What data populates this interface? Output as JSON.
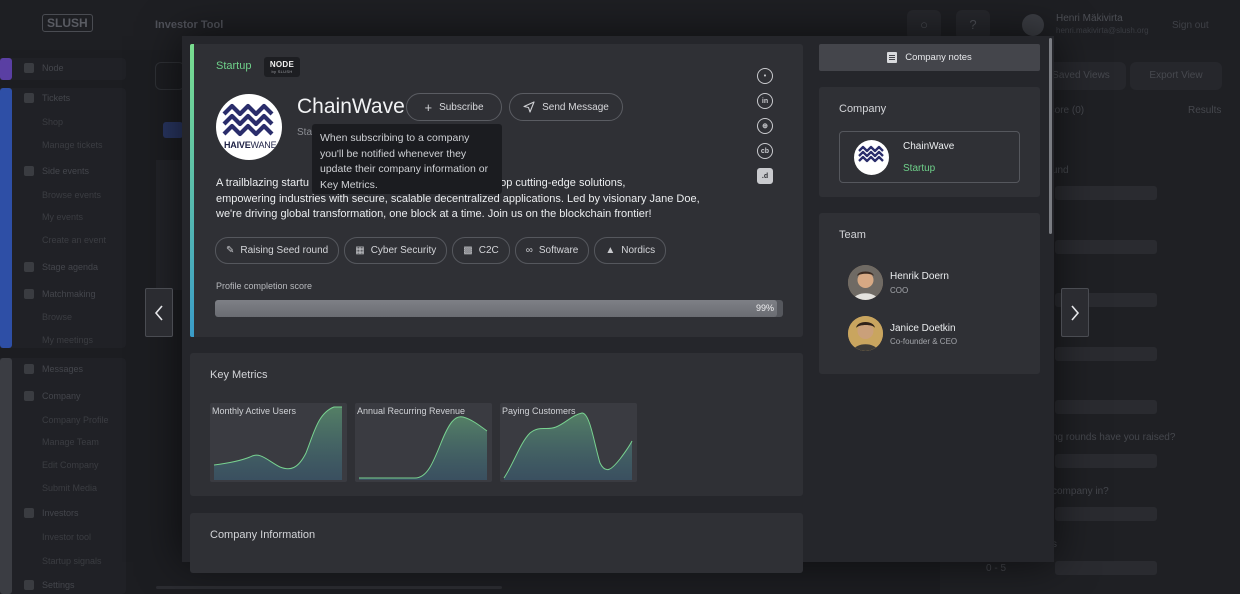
{
  "background": {
    "logo": "SLUSH",
    "page_title": "Investor Tool",
    "user_name": "Henri Mäkivirta",
    "user_email": "henri.makivirta@slush.org",
    "sign_out": "Sign out",
    "saved_views": "Saved Views",
    "export_view": "Export View",
    "score_col": "Score (0)",
    "results_col": "Results",
    "sidebar": [
      {
        "label": "Node",
        "kind": "head"
      },
      {
        "label": "Tickets",
        "kind": "head"
      },
      {
        "label": "Shop",
        "kind": "sub"
      },
      {
        "label": "Manage tickets",
        "kind": "sub"
      },
      {
        "label": "Side events",
        "kind": "head"
      },
      {
        "label": "Browse events",
        "kind": "sub"
      },
      {
        "label": "My events",
        "kind": "sub"
      },
      {
        "label": "Create an event",
        "kind": "sub"
      },
      {
        "label": "Stage agenda",
        "kind": "head"
      },
      {
        "label": "Matchmaking",
        "kind": "head"
      },
      {
        "label": "Browse",
        "kind": "sub"
      },
      {
        "label": "My meetings",
        "kind": "sub"
      },
      {
        "label": "Messages",
        "kind": "head"
      },
      {
        "label": "Company",
        "kind": "head"
      },
      {
        "label": "Company Profile",
        "kind": "sub"
      },
      {
        "label": "Manage Team",
        "kind": "sub"
      },
      {
        "label": "Edit Company",
        "kind": "sub"
      },
      {
        "label": "Submit Media",
        "kind": "sub"
      },
      {
        "label": "Investors",
        "kind": "head"
      },
      {
        "label": "Investor tool",
        "kind": "sub"
      },
      {
        "label": "Startup signals",
        "kind": "sub"
      },
      {
        "label": "Settings",
        "kind": "head"
      }
    ],
    "filters": [
      "round",
      "ng rounds have you raised?",
      "company in?",
      "s"
    ],
    "range_label": "0 - 5"
  },
  "profile": {
    "stage": "Startup",
    "partner_badge": "NODE",
    "partner_badge_sub": "by SLUSH",
    "logo_text_bold": "HAIVE",
    "logo_text_light": "WANE",
    "name": "ChainWave",
    "stage_sub": "Sta",
    "subscribe_label": "Subscribe",
    "send_message_label": "Send Message",
    "tooltip": "When subscribing to a company you'll be notified whenever they update their company information or Key Metrics.",
    "description_lines": [
      "A trailblazing startu                                    vation. We develop cutting-edge solutions,",
      "empowering industries with secure, scalable decentralized applications. Led by visionary Jane Doe,",
      "we're driving global transformation, one block at a time. Join us on the blockchain frontier!"
    ],
    "tags": [
      {
        "label": "Raising Seed round",
        "icon": "hand-coin-icon"
      },
      {
        "label": "Cyber Security",
        "icon": "building-icon"
      },
      {
        "label": "C2C",
        "icon": "briefcase-icon"
      },
      {
        "label": "Software",
        "icon": "handshake-icon"
      },
      {
        "label": "Nordics",
        "icon": "factory-icon"
      }
    ],
    "score_label": "Profile completion score",
    "score_value": 0.99,
    "score_text": "99%",
    "socials": [
      "chat-icon",
      "linkedin-icon",
      "globe-icon",
      "crunchbase-icon",
      "dealroom-icon"
    ]
  },
  "key_metrics": {
    "title": "Key Metrics",
    "charts": [
      {
        "label": "Monthly Active Users"
      },
      {
        "label": "Annual Recurring Revenue"
      },
      {
        "label": "Paying Customers"
      }
    ]
  },
  "company_information": {
    "title": "Company Information"
  },
  "sidebar_right": {
    "notes_label": "Company notes",
    "company_title": "Company",
    "company_name": "ChainWave",
    "company_stage": "Startup",
    "team_title": "Team",
    "team": [
      {
        "name": "Henrik Doern",
        "role": "COO"
      },
      {
        "name": "Janice Doetkin",
        "role": "Co-founder & CEO"
      }
    ]
  },
  "colors": {
    "accent_green": "#6fd08a",
    "accent_blue": "#3a9cc9"
  }
}
